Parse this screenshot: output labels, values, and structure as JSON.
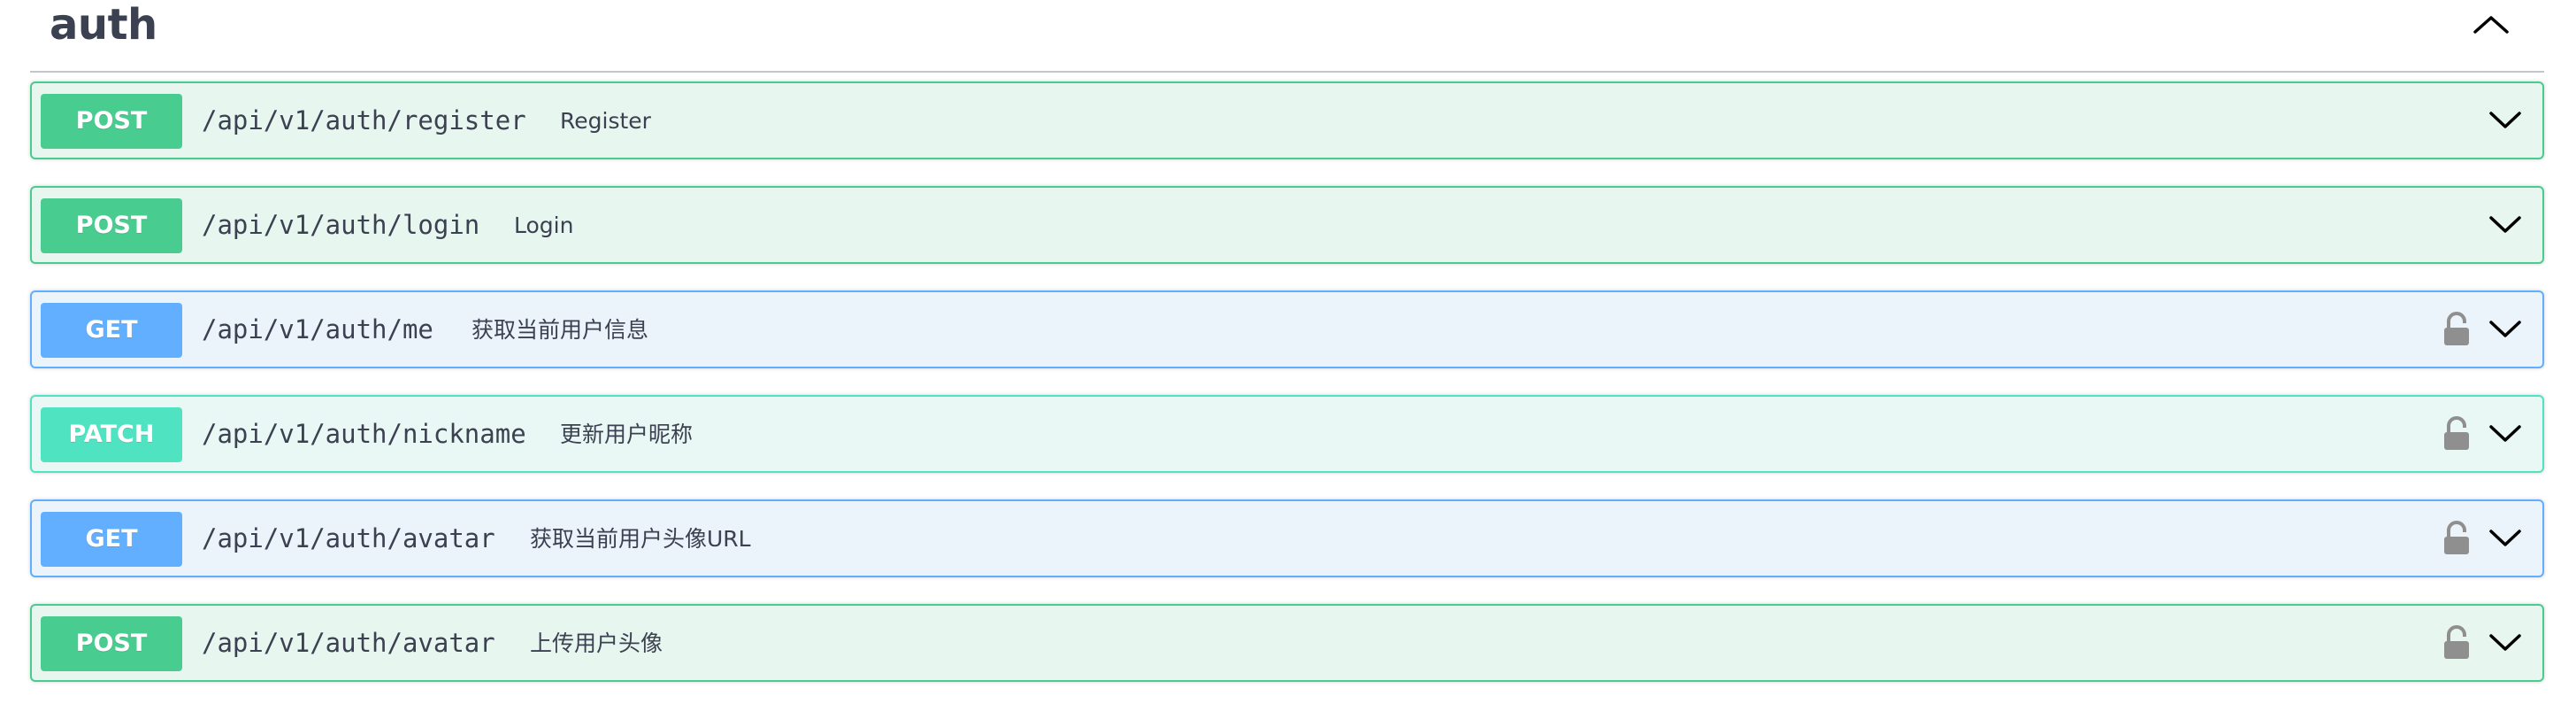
{
  "tag": {
    "name": "auth",
    "toggle_icon": "chevron-up-icon"
  },
  "colors": {
    "post": "#49cc90",
    "get": "#61affe",
    "patch": "#50e3c2",
    "text": "#3b4151",
    "lock": "#8f8f8f"
  },
  "operations": [
    {
      "method": "POST",
      "path": "/api/v1/auth/register",
      "summary": "Register",
      "locked": false
    },
    {
      "method": "POST",
      "path": "/api/v1/auth/login",
      "summary": "Login",
      "locked": false
    },
    {
      "method": "GET",
      "path": "/api/v1/auth/me",
      "summary": "获取当前用户信息",
      "locked": true
    },
    {
      "method": "PATCH",
      "path": "/api/v1/auth/nickname",
      "summary": "更新用户昵称",
      "locked": true
    },
    {
      "method": "GET",
      "path": "/api/v1/auth/avatar",
      "summary": "获取当前用户头像URL",
      "locked": true
    },
    {
      "method": "POST",
      "path": "/api/v1/auth/avatar",
      "summary": "上传用户头像",
      "locked": true
    }
  ]
}
